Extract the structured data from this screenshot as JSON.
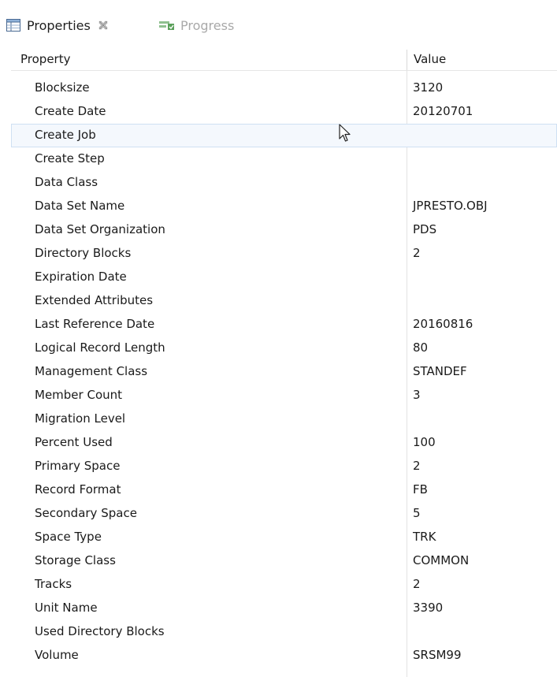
{
  "tabs": {
    "properties_label": "Properties",
    "progress_label": "Progress"
  },
  "table": {
    "col_property": "Property",
    "col_value": "Value",
    "rows": [
      {
        "property": "Blocksize",
        "value": "3120"
      },
      {
        "property": "Create Date",
        "value": "20120701"
      },
      {
        "property": "Create Job",
        "value": ""
      },
      {
        "property": "Create Step",
        "value": ""
      },
      {
        "property": "Data Class",
        "value": ""
      },
      {
        "property": "Data Set Name",
        "value": "JPRESTO.OBJ"
      },
      {
        "property": "Data Set Organization",
        "value": "PDS"
      },
      {
        "property": "Directory Blocks",
        "value": "2"
      },
      {
        "property": "Expiration Date",
        "value": ""
      },
      {
        "property": "Extended Attributes",
        "value": ""
      },
      {
        "property": "Last Reference Date",
        "value": "20160816"
      },
      {
        "property": "Logical Record Length",
        "value": "80"
      },
      {
        "property": "Management Class",
        "value": "STANDEF"
      },
      {
        "property": "Member Count",
        "value": "3"
      },
      {
        "property": "Migration Level",
        "value": ""
      },
      {
        "property": "Percent Used",
        "value": "100"
      },
      {
        "property": "Primary Space",
        "value": "2"
      },
      {
        "property": "Record Format",
        "value": "FB"
      },
      {
        "property": "Secondary Space",
        "value": "5"
      },
      {
        "property": "Space Type",
        "value": "TRK"
      },
      {
        "property": "Storage Class",
        "value": "COMMON"
      },
      {
        "property": "Tracks",
        "value": "2"
      },
      {
        "property": "Unit Name",
        "value": "3390"
      },
      {
        "property": "Used Directory Blocks",
        "value": ""
      },
      {
        "property": "Volume",
        "value": "SRSM99"
      }
    ]
  },
  "icons": {
    "properties_tab": "properties-table-icon",
    "close_tab": "close-icon",
    "progress_tab": "progress-icon",
    "cursor": "mouse-pointer-icon"
  },
  "colors": {
    "hover_row": "#f4f8fd",
    "hover_border": "#cfe0f3",
    "inactive_tab_text": "#a9a9a9",
    "progress_icon": "#5aa05a"
  }
}
